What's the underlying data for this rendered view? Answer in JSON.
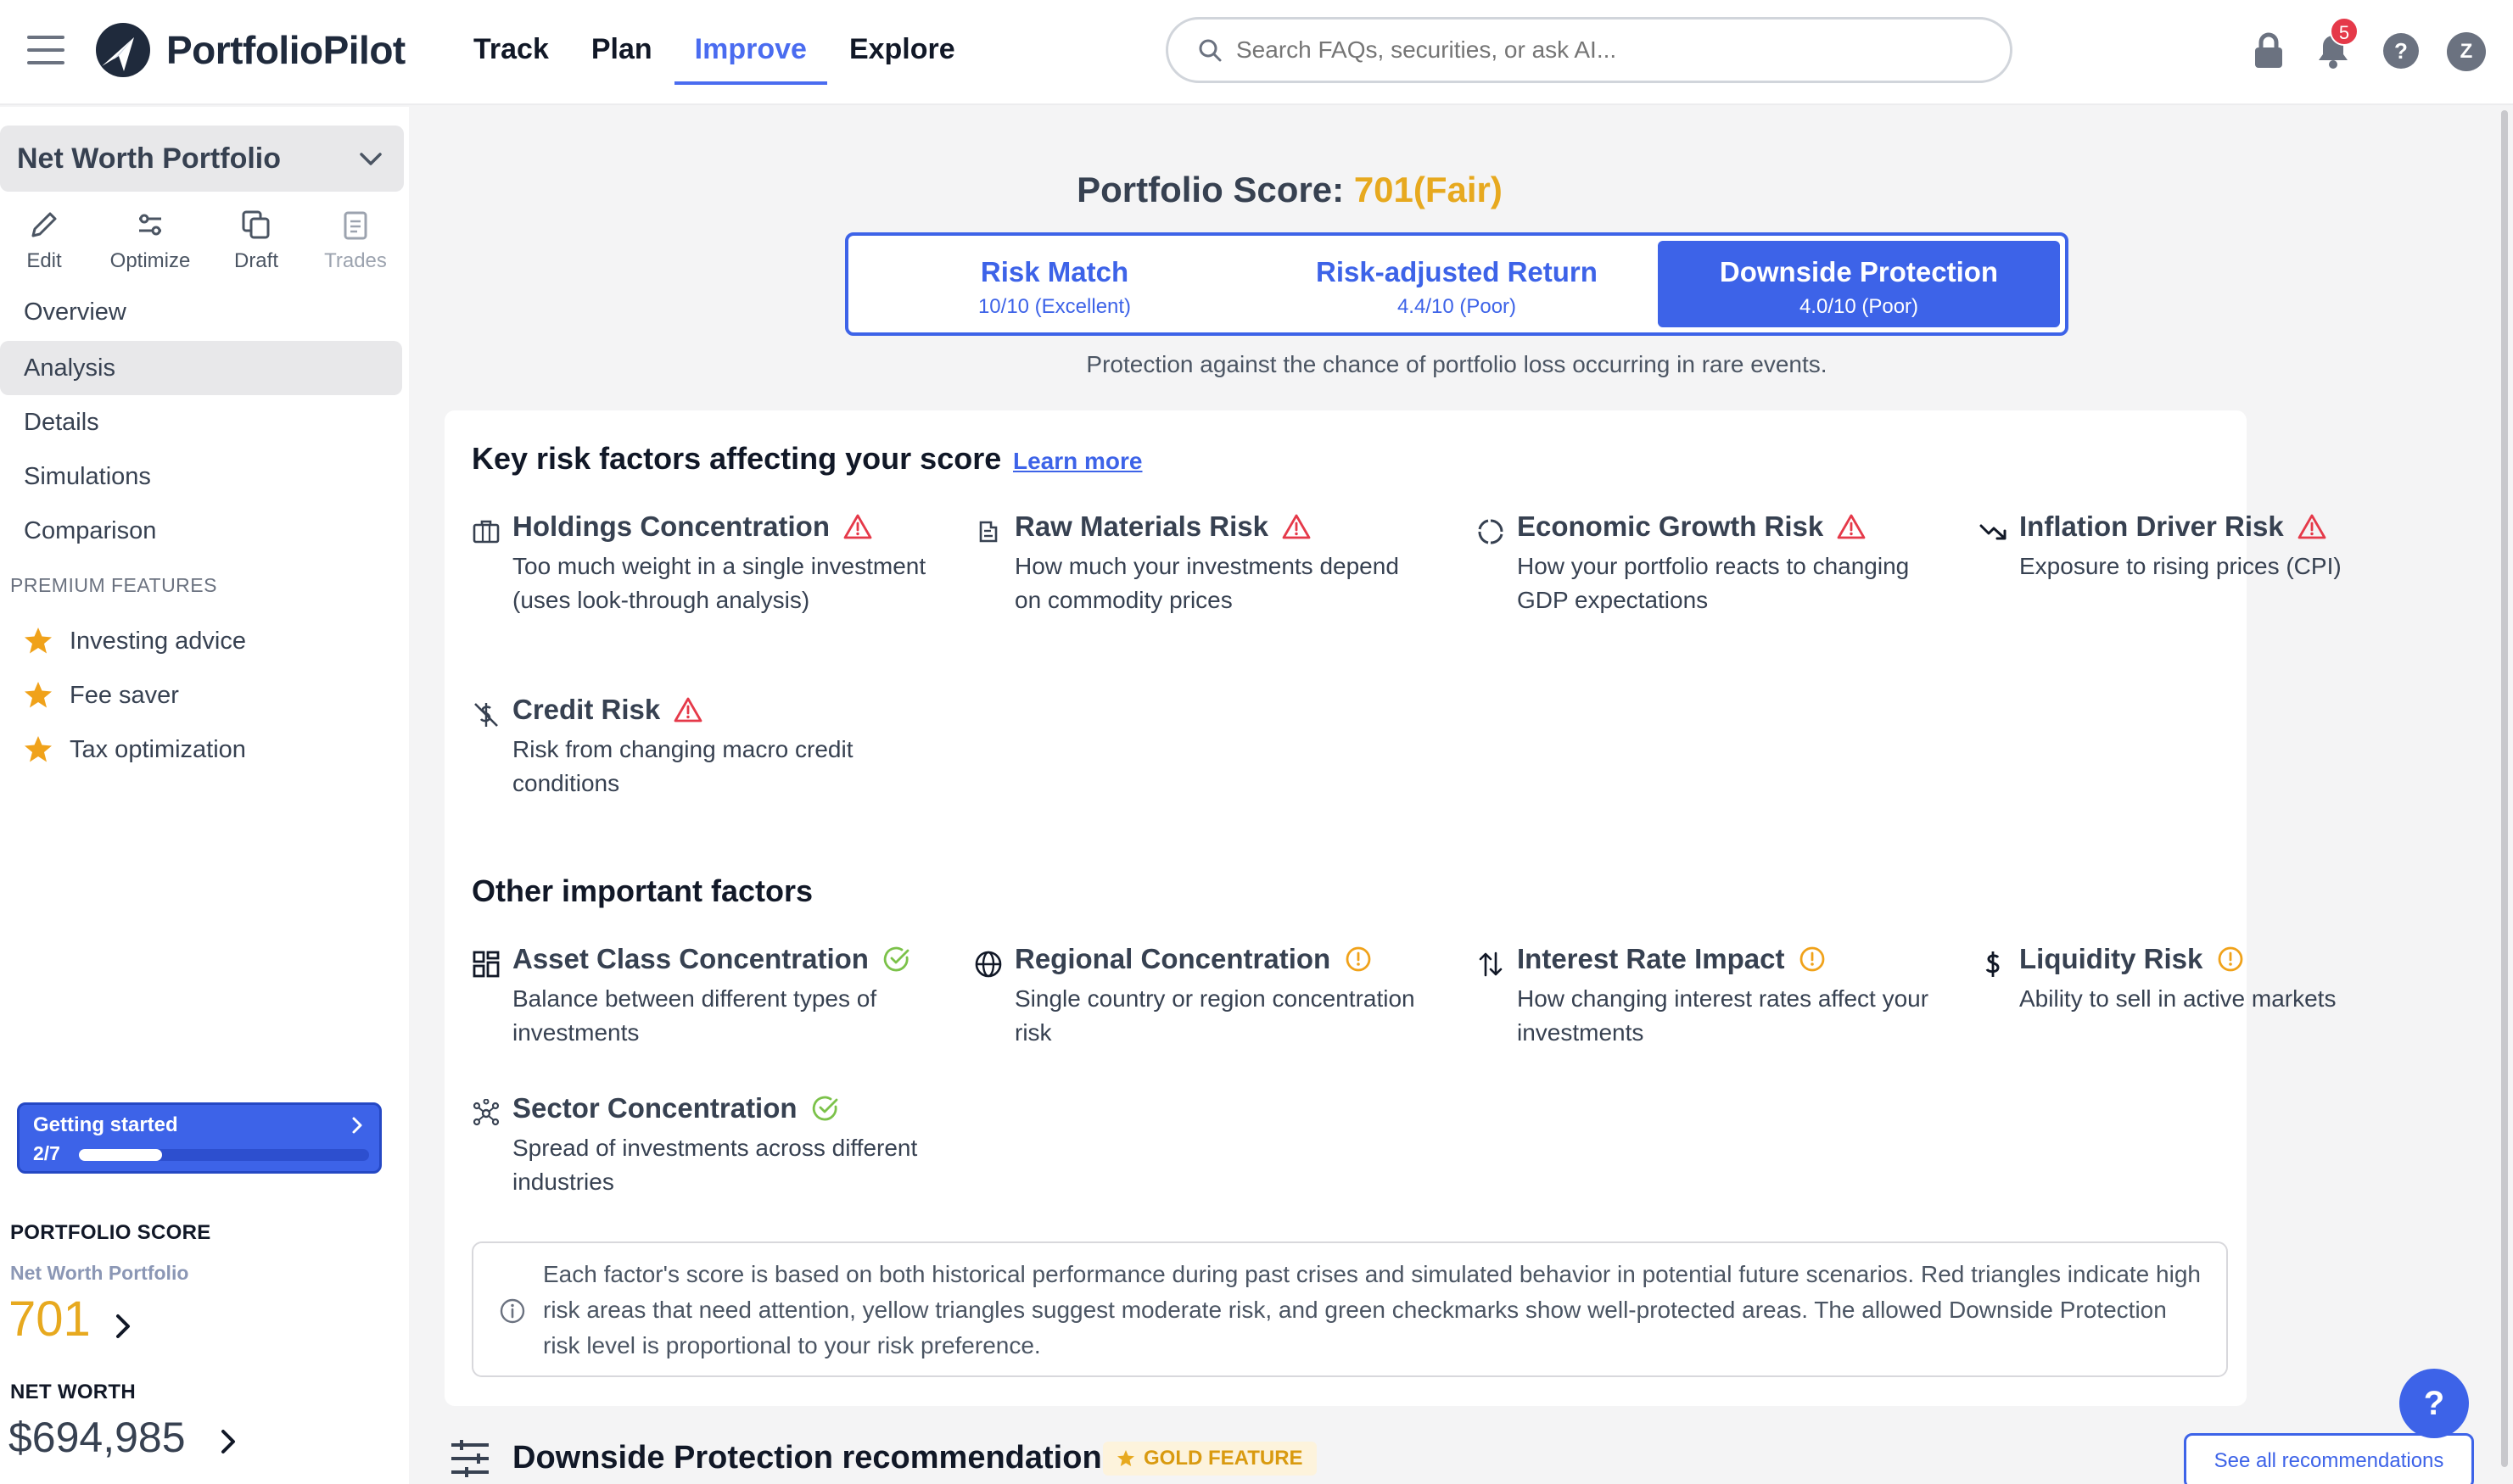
{
  "header": {
    "brand": "PortfolioPilot",
    "nav": [
      {
        "label": "Track",
        "active": false
      },
      {
        "label": "Plan",
        "active": false
      },
      {
        "label": "Improve",
        "active": true
      },
      {
        "label": "Explore",
        "active": false
      }
    ],
    "search_placeholder": "Search FAQs, securities, or ask AI...",
    "notification_count": "5",
    "avatar_initial": "Z"
  },
  "sidebar": {
    "portfolio_name": "Net Worth Portfolio",
    "tools": [
      {
        "label": "Edit",
        "icon": "pencil-icon"
      },
      {
        "label": "Optimize",
        "icon": "sliders-icon"
      },
      {
        "label": "Draft",
        "icon": "copy-icon"
      },
      {
        "label": "Trades",
        "icon": "clipboard-icon",
        "disabled": true
      }
    ],
    "items": [
      {
        "label": "Overview"
      },
      {
        "label": "Analysis",
        "active": true
      },
      {
        "label": "Details"
      },
      {
        "label": "Simulations"
      },
      {
        "label": "Comparison"
      }
    ],
    "premium_title": "PREMIUM FEATURES",
    "premium_items": [
      {
        "label": "Investing advice",
        "icon": "star-icon"
      },
      {
        "label": "Fee saver",
        "icon": "star-icon"
      },
      {
        "label": "Tax optimization",
        "icon": "star-icon"
      }
    ],
    "getting_started": {
      "title": "Getting started",
      "count": "2/7",
      "progress": 0.2857
    },
    "portfolio_score": {
      "title": "PORTFOLIO SCORE",
      "portfolio": "Net Worth Portfolio",
      "score": "701"
    },
    "net_worth": {
      "title": "NET WORTH",
      "value": "$694,985"
    }
  },
  "main": {
    "score_label": "Portfolio Score:",
    "score_value": "701",
    "score_rating": "(Fair)",
    "tabs": [
      {
        "title": "Risk Match",
        "sub": "10/10 (Excellent)",
        "active": false
      },
      {
        "title": "Risk-adjusted Return",
        "sub": "4.4/10 (Poor)",
        "active": false
      },
      {
        "title": "Downside Protection",
        "sub": "4.0/10 (Poor)",
        "active": true
      }
    ],
    "tab_description": "Protection against the chance of portfolio loss occurring in rare events.",
    "key_title": "Key risk factors affecting your score",
    "learn_more": "Learn more",
    "key_factors": [
      {
        "name": "Holdings Concentration",
        "desc": "Too much weight in a single investment (uses look-through analysis)",
        "icon": "briefcase-icon",
        "status": "warning-triangle-icon"
      },
      {
        "name": "Raw Materials Risk",
        "desc": "How much your investments depend on commodity prices",
        "icon": "materials-icon",
        "status": "warning-triangle-icon"
      },
      {
        "name": "Economic Growth Risk",
        "desc": "How your portfolio reacts to changing GDP expectations",
        "icon": "cycle-icon",
        "status": "warning-triangle-icon"
      },
      {
        "name": "Inflation Driver Risk",
        "desc": "Exposure to rising prices (CPI)",
        "icon": "trend-down-icon",
        "status": "warning-triangle-icon"
      },
      {
        "name": "Credit Risk",
        "desc": "Risk from changing macro credit conditions",
        "icon": "no-dollar-icon",
        "status": "warning-triangle-icon"
      }
    ],
    "other_title": "Other important factors",
    "other_factors": [
      {
        "name": "Asset Class Concentration",
        "desc": "Balance between different types of investments",
        "icon": "grid-icon",
        "status": "check-circle-icon"
      },
      {
        "name": "Regional Concentration",
        "desc": "Single country or region concentration risk",
        "icon": "globe-icon",
        "status": "alert-circle-icon"
      },
      {
        "name": "Interest Rate Impact",
        "desc": "How changing interest rates affect your investments",
        "icon": "arrows-updown-icon",
        "status": "alert-circle-icon"
      },
      {
        "name": "Liquidity Risk",
        "desc": "Ability to sell in active markets",
        "icon": "dollar-icon",
        "status": "alert-circle-icon"
      },
      {
        "name": "Sector Concentration",
        "desc": "Spread of investments across different industries",
        "icon": "network-icon",
        "status": "check-circle-icon"
      }
    ],
    "note": "Each factor's score is based on both historical performance during past crises and simulated behavior in potential future scenarios. Red triangles indicate high risk areas that need attention, yellow triangles suggest moderate risk, and green checkmarks show well-protected areas. The allowed Downside Protection risk level is proportional to your risk preference.",
    "rec_title": "Downside Protection recommendations",
    "gold_label": "GOLD FEATURE",
    "see_all": "See all recommendations",
    "help": "?"
  },
  "colors": {
    "accent": "#3d63e8",
    "score": "#e7a91f",
    "danger": "#e53949",
    "success": "#7cc24a",
    "warning": "#f0a21a"
  }
}
